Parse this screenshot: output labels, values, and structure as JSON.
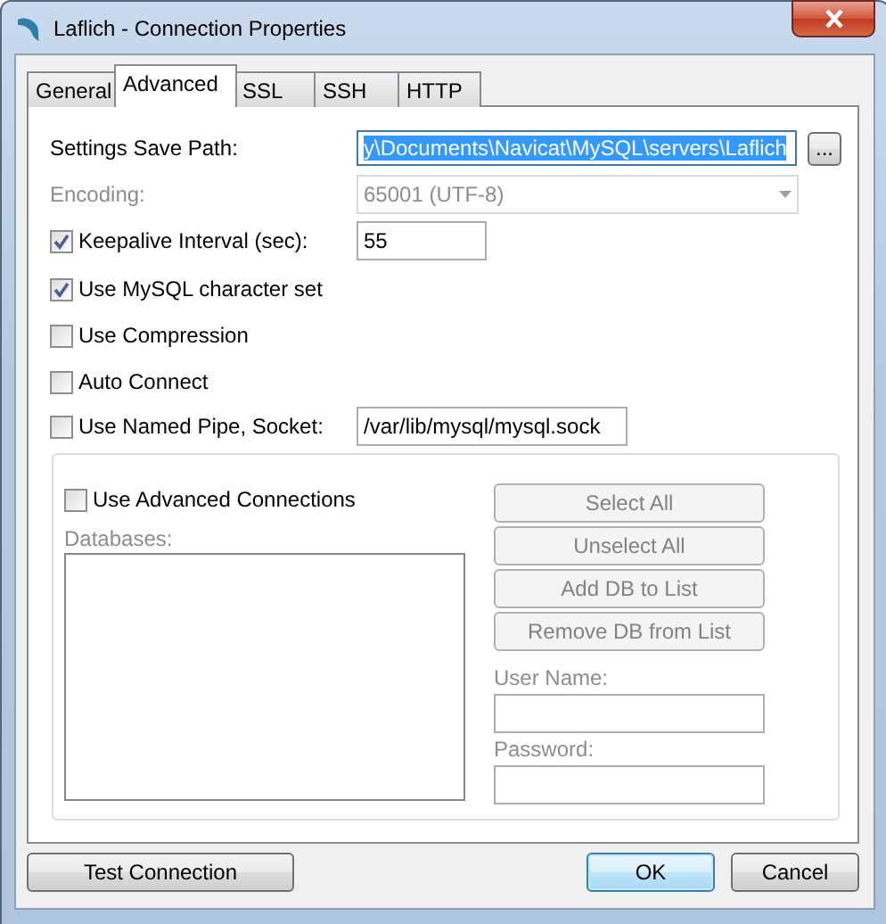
{
  "window": {
    "title": "Laflich - Connection Properties"
  },
  "tabs": [
    {
      "label": "General",
      "selected": false
    },
    {
      "label": "Advanced",
      "selected": true
    },
    {
      "label": "SSL",
      "selected": false
    },
    {
      "label": "SSH",
      "selected": false
    },
    {
      "label": "HTTP",
      "selected": false
    }
  ],
  "settings_save_path": {
    "label": "Settings Save Path:",
    "value": "y\\Documents\\Navicat\\MySQL\\servers\\Laflich",
    "text_selected": true,
    "browse_button": "..."
  },
  "encoding": {
    "label": "Encoding:",
    "value": "65001 (UTF-8)",
    "disabled": true
  },
  "options": [
    {
      "kind": "check_field",
      "label": "Keepalive Interval (sec):",
      "checked": true,
      "value": "55"
    },
    {
      "kind": "check",
      "label": "Use MySQL character set",
      "checked": true
    },
    {
      "kind": "check",
      "label": "Use Compression",
      "checked": false
    },
    {
      "kind": "check",
      "label": "Auto Connect",
      "checked": false
    },
    {
      "kind": "check_field",
      "label": "Use Named Pipe, Socket:",
      "checked": false,
      "value": "/var/lib/mysql/mysql.sock"
    }
  ],
  "advanced_connections": {
    "label": "Use Advanced Connections",
    "checked": false,
    "disabled": true,
    "databases_label": "Databases:",
    "buttons": [
      "Select All",
      "Unselect All",
      "Add DB to List",
      "Remove DB from List"
    ],
    "user_name_label": "User Name:",
    "password_label": "Password:"
  },
  "buttons": [
    {
      "kind": "normal",
      "label": "Test Connection"
    },
    {
      "kind": "spacer"
    },
    {
      "kind": "default",
      "label": "OK"
    },
    {
      "kind": "normal",
      "label": "Cancel"
    }
  ]
}
